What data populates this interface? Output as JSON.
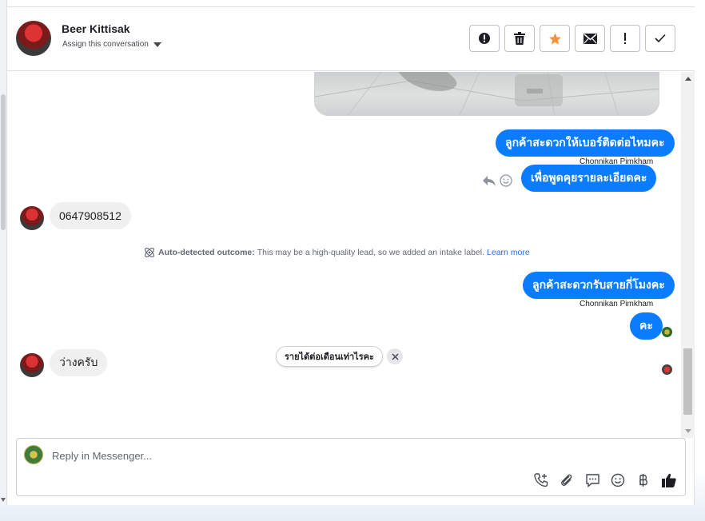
{
  "header": {
    "contact_name": "Beer Kittisak",
    "assign_label": "Assign this conversation"
  },
  "actions": [
    {
      "name": "mark-spam-button",
      "icon": "alert-circle-icon"
    },
    {
      "name": "delete-button",
      "icon": "trash-icon"
    },
    {
      "name": "star-button",
      "icon": "star-icon"
    },
    {
      "name": "mark-unread-button",
      "icon": "envelope-icon"
    },
    {
      "name": "follow-up-button",
      "icon": "exclamation-icon"
    },
    {
      "name": "mark-done-button",
      "icon": "check-icon"
    }
  ],
  "messages": {
    "out1": "ลูกค้าสะดวกให้เบอร์ติดต่อไหมคะ",
    "out1_sender": "Chonnikan Pimkham",
    "out2": "เพื่อพูดคุยรายละเอียดคะ",
    "in1": "0647908512",
    "outcome_label": "Auto-detected outcome:",
    "outcome_text": " This may be a high-quality lead, so we added an intake label. ",
    "outcome_link": "Learn more",
    "out3": "ลูกค้าสะดวกรับสายกี่โมงคะ",
    "out3_sender": "Chonnikan Pimkham",
    "out4": "คะ",
    "in2": "ว่างครับ",
    "suggestion": "รายได้ต่อเดือนเท่าไรคะ"
  },
  "composer": {
    "placeholder": "Reply in Messenger..."
  },
  "colors": {
    "accent": "#0a7cff",
    "star": "#f7923b",
    "link": "#216fdb"
  }
}
